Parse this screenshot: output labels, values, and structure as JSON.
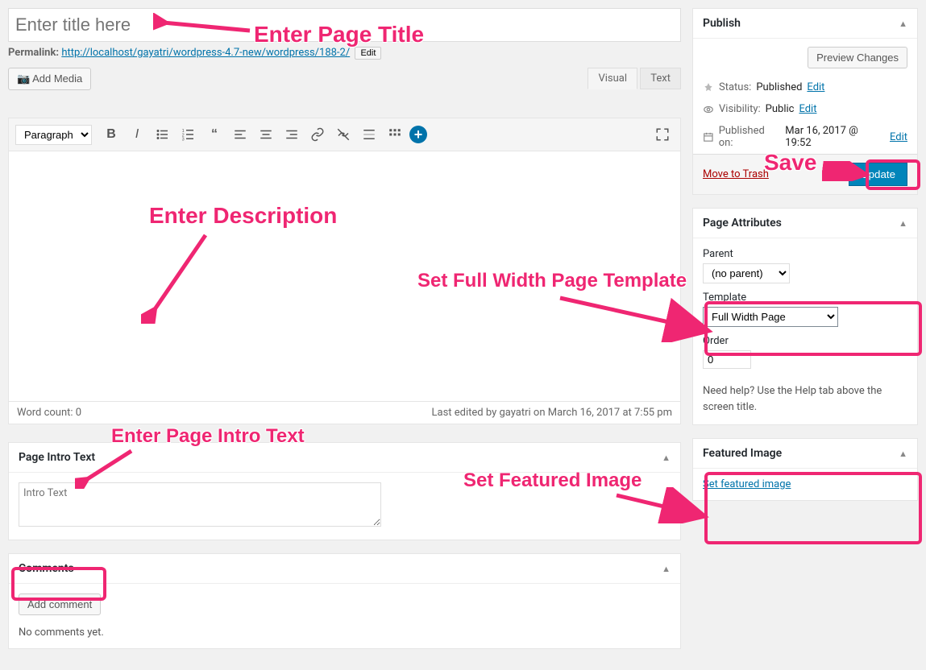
{
  "editor": {
    "title_placeholder": "Enter title here",
    "permalink_label": "Permalink:",
    "permalink_url": "http://localhost/gayatri/wordpress-4.7-new/wordpress/188-2/",
    "permalink_edit": "Edit",
    "add_media": "Add Media",
    "tab_visual": "Visual",
    "tab_text": "Text",
    "format_dropdown": "Paragraph",
    "word_count": "Word count: 0",
    "last_edited": "Last edited by gayatri on March 16, 2017 at 7:55 pm"
  },
  "intro_box": {
    "title": "Page Intro Text",
    "placeholder": "Intro Text"
  },
  "comments_box": {
    "title": "Comments",
    "add_btn": "Add comment",
    "empty": "No comments yet."
  },
  "publish": {
    "title": "Publish",
    "preview_btn": "Preview Changes",
    "status_label": "Status:",
    "status_value": "Published",
    "visibility_label": "Visibility:",
    "visibility_value": "Public",
    "published_label": "Published on:",
    "published_value": "Mar 16, 2017 @ 19:52",
    "edit": "Edit",
    "trash": "Move to Trash",
    "update": "Update"
  },
  "attributes": {
    "title": "Page Attributes",
    "parent_label": "Parent",
    "parent_value": "(no parent)",
    "template_label": "Template",
    "template_value": "Full Width Page",
    "order_label": "Order",
    "order_value": "0",
    "help": "Need help? Use the Help tab above the screen title."
  },
  "featured": {
    "title": "Featured Image",
    "link": "Set featured image"
  },
  "annotations": {
    "title": "Enter Page Title",
    "desc": "Enter Description",
    "template": "Set Full Width Page Template",
    "save": "Save",
    "intro": "Enter Page Intro Text",
    "featured": "Set Featured Image"
  }
}
